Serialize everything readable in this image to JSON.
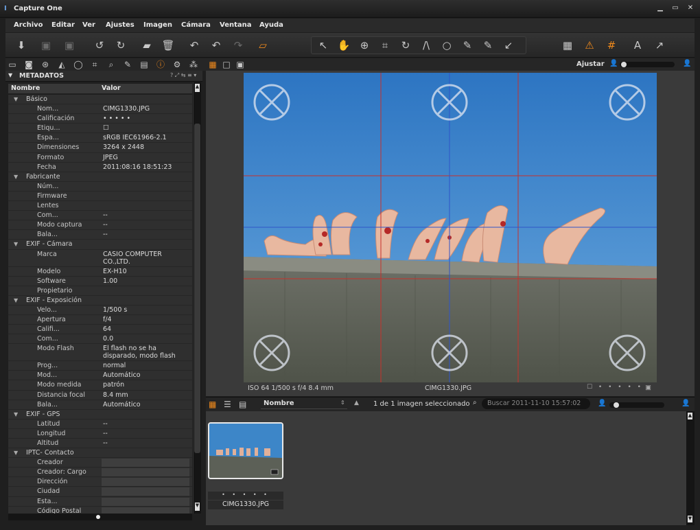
{
  "window": {
    "title": "Capture One",
    "minimize": "▁",
    "maximize": "▭",
    "close": "✕"
  },
  "menu": [
    "Archivo",
    "Editar",
    "Ver",
    "Ajustes",
    "Imagen",
    "Cámara",
    "Ventana",
    "Ayuda"
  ],
  "toolbar": {
    "icons": [
      "import-icon",
      "capture-icon",
      "compare-icon",
      "rotate-left-icon",
      "rotate-right-icon",
      "process-icon",
      "trash-icon",
      "undo-all-icon",
      "undo-icon",
      "redo-icon",
      "variants-icon",
      "select-cursor-icon",
      "pan-hand-icon",
      "zoom-icon",
      "crop-icon",
      "straighten-icon",
      "keystone-icon",
      "spot-remove-icon",
      "color-picker-icon",
      "white-balance-picker-icon",
      "annotate-pen-icon",
      "grid-view-icon",
      "warning-icon",
      "overlay-grid-icon",
      "text-icon",
      "share-arrow-icon"
    ]
  },
  "viewer_bar": {
    "label": "Ajustar"
  },
  "panel": {
    "title": "METADATOS",
    "col_name": "Nombre",
    "col_value": "Valor"
  },
  "metadata": [
    {
      "type": "group",
      "k": "Básico"
    },
    {
      "k": "Nom...",
      "v": "CIMG1330.JPG"
    },
    {
      "k": "Calificación",
      "v": "• • • • •"
    },
    {
      "k": "Etiqu...",
      "v": "☐"
    },
    {
      "k": "Espa...",
      "v": "sRGB IEC61966-2.1"
    },
    {
      "k": "Dimensiones",
      "v": "3264 x 2448"
    },
    {
      "k": "Formato",
      "v": "JPEG"
    },
    {
      "k": "Fecha",
      "v": "2011:08:16 18:51:23"
    },
    {
      "type": "group",
      "k": "Fabricante"
    },
    {
      "k": "Núm...",
      "v": ""
    },
    {
      "k": "Firmware",
      "v": ""
    },
    {
      "k": "Lentes",
      "v": ""
    },
    {
      "k": "Com...",
      "v": "--"
    },
    {
      "k": "Modo captura",
      "v": "--"
    },
    {
      "k": "Bala...",
      "v": "--"
    },
    {
      "type": "group",
      "k": "EXIF - Cámara"
    },
    {
      "k": "Marca",
      "v": "CASIO COMPUTER",
      "v2": "CO.,LTD.",
      "tall": true
    },
    {
      "k": "Modelo",
      "v": "EX-H10"
    },
    {
      "k": "Software",
      "v": "1.00"
    },
    {
      "k": "Propietario",
      "v": ""
    },
    {
      "type": "group",
      "k": "EXIF - Exposición"
    },
    {
      "k": "Velo...",
      "v": "1/500 s"
    },
    {
      "k": "Apertura",
      "v": "f/4"
    },
    {
      "k": "Califi...",
      "v": "64"
    },
    {
      "k": "Com...",
      "v": "0.0"
    },
    {
      "k": "Modo Flash",
      "v": "El flash no se ha",
      "v2": "disparado, modo flash",
      "tall": true
    },
    {
      "k": "Prog...",
      "v": "normal"
    },
    {
      "k": "Mod...",
      "v": "Automático"
    },
    {
      "k": "Modo medida",
      "v": "patrón"
    },
    {
      "k": "Distancia focal",
      "v": "8.4 mm"
    },
    {
      "k": "Bala...",
      "v": "Automático"
    },
    {
      "type": "group",
      "k": "EXIF - GPS"
    },
    {
      "k": "Latitud",
      "v": "--"
    },
    {
      "k": "Longitud",
      "v": "--"
    },
    {
      "k": "Altitud",
      "v": "--"
    },
    {
      "type": "group",
      "k": "IPTC- Contacto"
    },
    {
      "k": "Creador",
      "v": "",
      "field": true
    },
    {
      "k": "Creador: Cargo",
      "v": "",
      "field": true
    },
    {
      "k": "Dirección",
      "v": "",
      "field": true
    },
    {
      "k": "Ciudad",
      "v": "",
      "field": true
    },
    {
      "k": "Esta...",
      "v": "",
      "field": true
    },
    {
      "k": "Código Postal",
      "v": "",
      "field": true
    }
  ],
  "viewer_info": {
    "exposure": "ISO 64  1/500 s f/4 8.4 mm",
    "filename": "CIMG1330.JPG"
  },
  "browser": {
    "sort_label": "Nombre",
    "count_text": "1 de 1 imagen seleccionado",
    "search_placeholder": "Buscar 2011-11-10 15:57:02",
    "thumb_name": "CIMG1330.JPG",
    "thumb_rating": "• • • • •"
  },
  "colors": {
    "accent": "#f08a1c",
    "grid_red": "#c8302a",
    "grid_blue": "#2f55c8",
    "sky": "#3d86c8"
  }
}
